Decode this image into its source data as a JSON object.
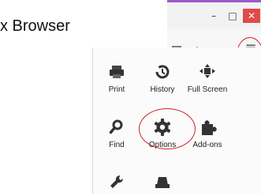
{
  "title": "x Browser",
  "window": {
    "minimize_glyph": "–",
    "maximize_glyph": "□",
    "close_glyph": "✕"
  },
  "toolbar": {
    "icons": [
      "pocket-icon",
      "download-icon",
      "home-icon",
      "menu-icon"
    ],
    "download_glyph": "↓",
    "home_glyph": "⌂",
    "menu_glyph": "≡"
  },
  "menu": {
    "items": [
      {
        "label": "Print",
        "icon": "printer-icon"
      },
      {
        "label": "History",
        "icon": "history-icon"
      },
      {
        "label": "Full Screen",
        "icon": "fullscreen-icon"
      },
      {
        "label": "Find",
        "icon": "search-icon"
      },
      {
        "label": "Options",
        "icon": "gear-icon"
      },
      {
        "label": "Add-ons",
        "icon": "puzzle-icon"
      },
      {
        "label": "",
        "icon": "wrench-icon"
      },
      {
        "label": "",
        "icon": "private-mask-icon"
      }
    ]
  },
  "accent_colors": {
    "callout": "#d0202a",
    "titlebar_accent": "#9b59c9",
    "close_button": "#e04a4a"
  }
}
